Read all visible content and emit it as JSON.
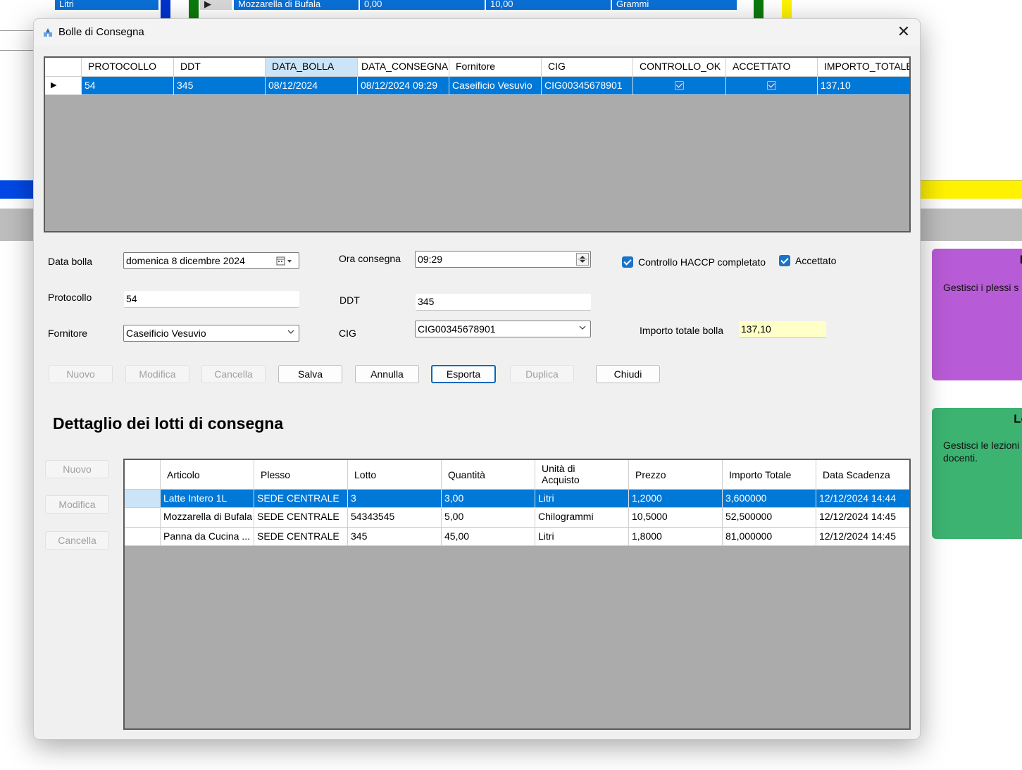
{
  "background": {
    "top_cells": [
      "Litri",
      "Mozzarella di Bufala",
      "0,00",
      "10,00",
      "Grammi"
    ],
    "tile_purple": {
      "title": "P",
      "text": "Gestisci i plessi sc"
    },
    "tile_green": {
      "title": "Le",
      "text": "Gestisci le lezioni",
      "text2": "docenti."
    },
    "colors": {
      "blue": "#0048e6",
      "yellow": "#fff200",
      "purple": "#b85bd6",
      "green": "#3cb371"
    }
  },
  "dialog": {
    "title": "Bolle di Consegna",
    "close_glyph": "✕"
  },
  "bolle_grid": {
    "columns": [
      "",
      "PROTOCOLLO",
      "DDT",
      "DATA_BOLLA",
      "DATA_CONSEGNA",
      "Fornitore",
      "CIG",
      "CONTROLLO_OK",
      "ACCETTATO",
      "IMPORTO_TOTALE"
    ],
    "rows": [
      {
        "indicator": "▶",
        "protocollo": "54",
        "ddt": "345",
        "data_bolla": "08/12/2024",
        "data_consegna": "08/12/2024 09:29",
        "fornitore": "Caseificio Vesuvio",
        "cig": "CIG00345678901",
        "controllo_ok": true,
        "accettato": true,
        "importo_totale": "137,10"
      }
    ]
  },
  "form": {
    "data_bolla_label": "Data bolla",
    "data_bolla_value": "domenica    8  dicembre  2024",
    "ora_consegna_label": "Ora consegna",
    "ora_consegna_value": "09:29",
    "haccp_label": "Controllo HACCP completato",
    "accettato_label": "Accettato",
    "protocollo_label": "Protocollo",
    "protocollo_value": "54",
    "ddt_label": "DDT",
    "ddt_value": "345",
    "fornitore_label": "Fornitore",
    "fornitore_value": "Caseificio Vesuvio",
    "cig_label": "CIG",
    "cig_value": "CIG00345678901",
    "importo_label": "Importo totale bolla",
    "importo_value": "137,10"
  },
  "buttons": {
    "nuovo": "Nuovo",
    "modifica": "Modifica",
    "cancella": "Cancella",
    "salva": "Salva",
    "annulla": "Annulla",
    "esporta": "Esporta",
    "duplica": "Duplica",
    "chiudi": "Chiudi"
  },
  "detail": {
    "title": "Dettaglio dei lotti di consegna",
    "side_buttons": {
      "nuovo": "Nuovo",
      "modifica": "Modifica",
      "cancella": "Cancella"
    },
    "columns": [
      "",
      "Articolo",
      "Plesso",
      "Lotto",
      "Quantità",
      "Unità di Acquisto",
      "Prezzo",
      "Importo Totale",
      "Data Scadenza"
    ],
    "rows": [
      {
        "articolo": "Latte Intero 1L",
        "plesso": "SEDE CENTRALE",
        "lotto": "3",
        "quantita": "3,00",
        "unita": "Litri",
        "prezzo": "1,2000",
        "importo": "3,600000",
        "scadenza": "12/12/2024 14:44"
      },
      {
        "articolo": "Mozzarella di Bufala",
        "plesso": "SEDE CENTRALE",
        "lotto": "54343545",
        "quantita": "5,00",
        "unita": "Chilogrammi",
        "prezzo": "10,5000",
        "importo": "52,500000",
        "scadenza": "12/12/2024 14:45"
      },
      {
        "articolo": "Panna da Cucina ...",
        "plesso": "SEDE CENTRALE",
        "lotto": "345",
        "quantita": "45,00",
        "unita": "Litri",
        "prezzo": "1,8000",
        "importo": "81,000000",
        "scadenza": "12/12/2024 14:45"
      }
    ]
  },
  "colors": {
    "selection": "#0078d7",
    "accent": "#1a73c9",
    "importo_bg": "#ffffc8"
  }
}
